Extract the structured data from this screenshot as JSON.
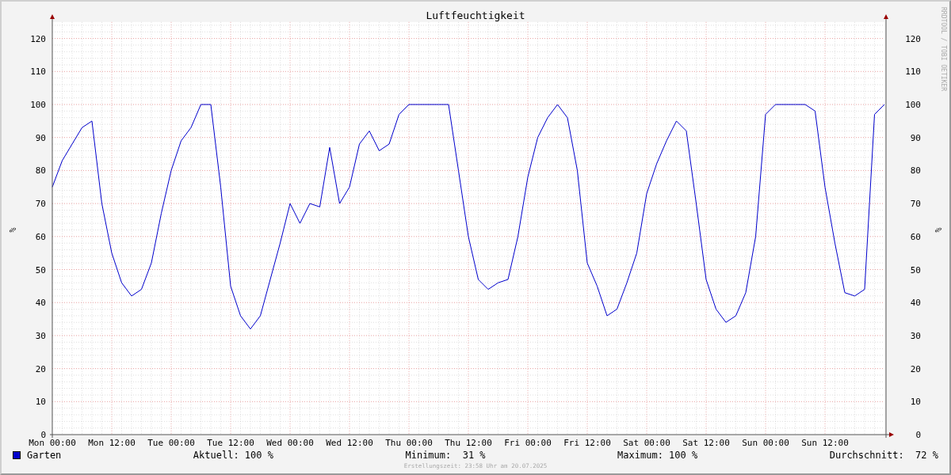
{
  "graph": {
    "chart_data": {
      "type": "line",
      "title": "Luftfeuchtigkeit",
      "ylabel": "%",
      "ylim": [
        0,
        125
      ],
      "grid": true,
      "categories": [
        "Mon 00:00",
        null,
        null,
        null,
        null,
        null,
        "Mon 12:00",
        null,
        null,
        null,
        null,
        null,
        "Tue 00:00",
        null,
        null,
        null,
        null,
        null,
        "Tue 12:00",
        null,
        null,
        null,
        null,
        null,
        "Wed 00:00",
        null,
        null,
        null,
        null,
        null,
        "Wed 12:00",
        null,
        null,
        null,
        null,
        null,
        "Thu 00:00",
        null,
        null,
        null,
        null,
        null,
        "Thu 12:00",
        null,
        null,
        null,
        null,
        null,
        "Fri 00:00",
        null,
        null,
        null,
        null,
        null,
        "Fri 12:00",
        null,
        null,
        null,
        null,
        null,
        "Sat 00:00",
        null,
        null,
        null,
        null,
        null,
        "Sat 12:00",
        null,
        null,
        null,
        null,
        null,
        "Sun 00:00",
        null,
        null,
        null,
        null,
        null,
        "Sun 12:00",
        null,
        null,
        null,
        null,
        null,
        null
      ],
      "yticks": [
        0,
        10,
        20,
        30,
        40,
        50,
        60,
        70,
        80,
        90,
        100,
        110,
        120
      ],
      "series": [
        {
          "name": "Garten",
          "color": "#0000cc",
          "values": [
            75,
            83,
            88,
            93,
            95,
            70,
            55,
            46,
            42,
            44,
            52,
            67,
            80,
            89,
            93,
            100,
            100,
            75,
            45,
            36,
            32,
            36,
            47,
            58,
            70,
            64,
            70,
            69,
            87,
            70,
            75,
            88,
            92,
            86,
            88,
            97,
            100,
            100,
            100,
            100,
            100,
            80,
            60,
            47,
            44,
            46,
            47,
            60,
            78,
            90,
            96,
            100,
            96,
            80,
            52,
            45,
            36,
            38,
            46,
            55,
            73,
            82,
            89,
            95,
            92,
            70,
            47,
            38,
            34,
            36,
            43,
            60,
            97,
            100,
            100,
            100,
            100,
            98,
            75,
            58,
            43,
            42,
            44,
            97,
            100
          ]
        }
      ]
    },
    "right_axis": {
      "label": "%",
      "ticks": [
        "120",
        "110",
        "100",
        "90",
        "80",
        "70",
        "60",
        "50",
        "40",
        "30",
        "20",
        "10",
        "0"
      ]
    },
    "side_text": "RRDTOOL / TOBI OETIKER"
  },
  "legend": {
    "current": "Aktuell: 100 %",
    "minimum": "Minimum:  31 %",
    "maximum": "Maximum: 100 %",
    "average": "Durchschnitt:  72 %"
  },
  "footer": "Erstellungszeit: 23:58 Uhr am 20.07.2025"
}
